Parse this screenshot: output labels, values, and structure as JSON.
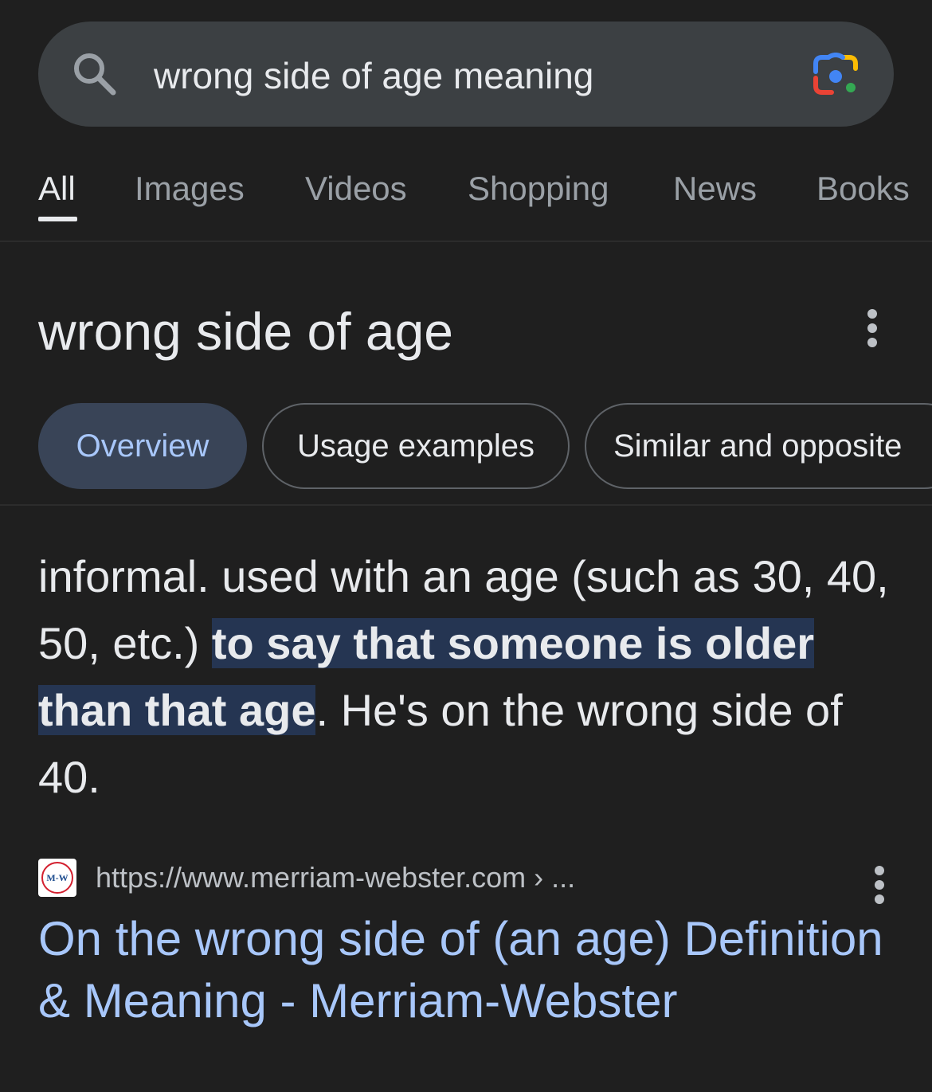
{
  "search": {
    "query": "wrong side of age meaning"
  },
  "tabs": [
    {
      "label": "All",
      "active": true
    },
    {
      "label": "Images"
    },
    {
      "label": "Videos"
    },
    {
      "label": "Shopping"
    },
    {
      "label": "News"
    },
    {
      "label": "Books"
    }
  ],
  "card": {
    "title": "wrong side of age",
    "chips": [
      {
        "label": "Overview",
        "active": true
      },
      {
        "label": "Usage examples"
      },
      {
        "label": "Similar and opposite"
      }
    ],
    "definition": {
      "before": "informal. used with an age (such as 30, 40, 50, etc.) ",
      "highlight": "to say that someone is older than that age",
      "after": ". He's on the wrong side of 40."
    }
  },
  "result": {
    "favicon_text": "M-W",
    "url": "https://www.merriam-webster.com › ...",
    "title": "On the wrong side of (an age) Definition & Meaning - Merriam-Webster"
  },
  "colors": {
    "background": "#1f1f1f",
    "search_bar": "#3c4043",
    "link": "#a8c7fa",
    "highlight": "#253552",
    "chip_active": "#394457"
  }
}
